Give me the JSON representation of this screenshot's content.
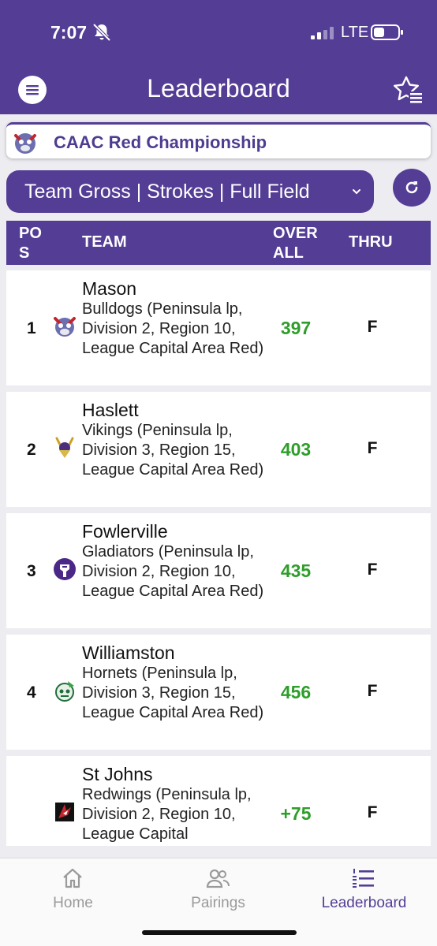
{
  "status_bar": {
    "time": "7:07",
    "network": "LTE"
  },
  "header": {
    "title": "Leaderboard",
    "menu_icon": "menu-icon",
    "favorite_icon": "star-list-icon"
  },
  "event": {
    "title": "CAAC Red Championship"
  },
  "filter": {
    "label": "Team Gross | Strokes | Full Field",
    "refresh_icon": "refresh-icon"
  },
  "table": {
    "headers": {
      "pos_line1": "PO",
      "pos_line2": "S",
      "team": "TEAM",
      "overall_line1": "OVER",
      "overall_line2": "ALL",
      "thru": "THRU"
    },
    "rows": [
      {
        "pos": "1",
        "name": "Mason",
        "desc": "Bulldogs (Peninsula lp, Division 2, Region 10, League Capital Area Red)",
        "score": "397",
        "thru": "F",
        "logo": "bulldog-logo-icon"
      },
      {
        "pos": "2",
        "name": "Haslett",
        "desc": "Vikings (Peninsula lp, Division 3, Region 15, League Capital Area Red)",
        "score": "403",
        "thru": "F",
        "logo": "viking-logo-icon"
      },
      {
        "pos": "3",
        "name": "Fowlerville",
        "desc": "Gladiators (Peninsula lp, Division 2, Region 10, League Capital Area Red)",
        "score": "435",
        "thru": "F",
        "logo": "gladiator-logo-icon"
      },
      {
        "pos": "4",
        "name": "Williamston",
        "desc": "Hornets (Peninsula lp, Division 3, Region 15, League Capital Area Red)",
        "score": "456",
        "thru": "F",
        "logo": "hornet-logo-icon"
      },
      {
        "pos": "",
        "name": "St Johns",
        "desc": "Redwings (Peninsula lp, Division 2, Region 10, League Capital",
        "score": "+75",
        "thru": "F",
        "logo": "redwing-logo-icon"
      }
    ]
  },
  "tabs": [
    {
      "label": "Home",
      "icon": "home-icon",
      "active": false
    },
    {
      "label": "Pairings",
      "icon": "people-icon",
      "active": false
    },
    {
      "label": "Leaderboard",
      "icon": "ranked-list-icon",
      "active": true
    }
  ],
  "colors": {
    "primary": "#543d95",
    "score_green": "#2e9e2a",
    "inactive_tab": "#9a9a9a"
  }
}
